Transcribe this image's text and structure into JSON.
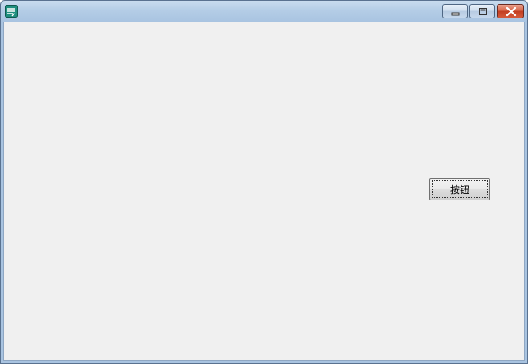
{
  "window": {
    "title": "",
    "controls": {
      "minimize_icon": "minimize-icon",
      "maximize_icon": "maximize-icon",
      "close_icon": "close-icon"
    }
  },
  "main": {
    "button_label": "按钮"
  }
}
